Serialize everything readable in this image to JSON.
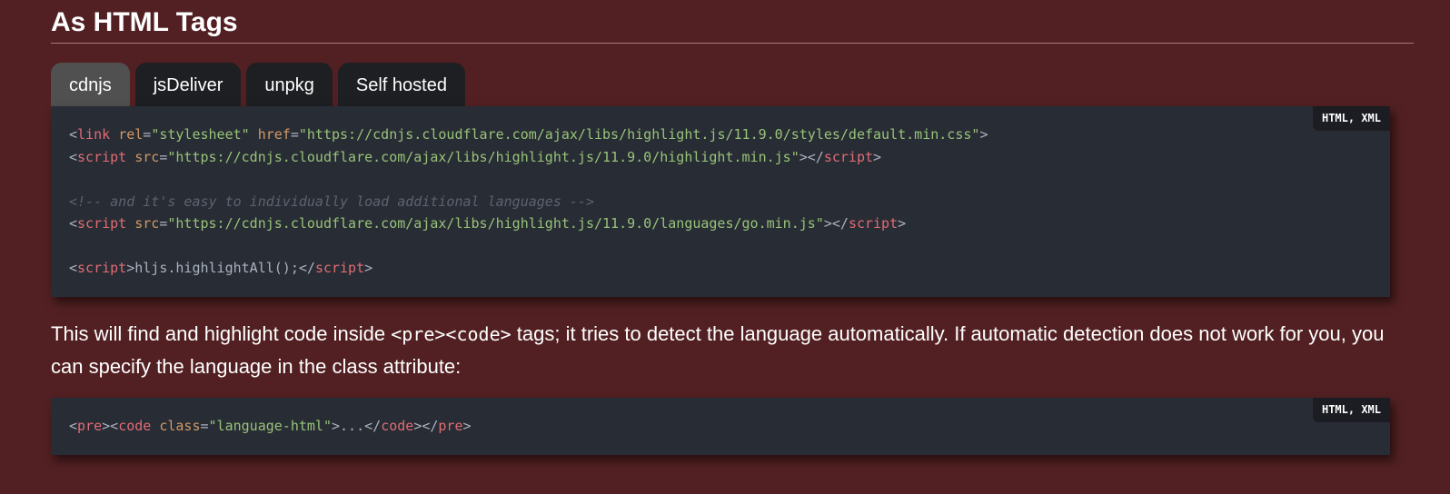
{
  "section": {
    "heading": "As HTML Tags"
  },
  "tabs": [
    {
      "label": "cdnjs",
      "active": true
    },
    {
      "label": "jsDeliver",
      "active": false
    },
    {
      "label": "unpkg",
      "active": false
    },
    {
      "label": "Self hosted",
      "active": false
    }
  ],
  "code_block_1": {
    "language_badge": "HTML, XML",
    "lines": [
      [
        {
          "t": "<",
          "k": "punc"
        },
        {
          "t": "link",
          "k": "tag"
        },
        {
          "t": " ",
          "k": "punc"
        },
        {
          "t": "rel",
          "k": "attr"
        },
        {
          "t": "=",
          "k": "punc"
        },
        {
          "t": "\"stylesheet\"",
          "k": "str"
        },
        {
          "t": " ",
          "k": "punc"
        },
        {
          "t": "href",
          "k": "attr"
        },
        {
          "t": "=",
          "k": "punc"
        },
        {
          "t": "\"https://cdnjs.cloudflare.com/ajax/libs/highlight.js/11.9.0/styles/default.min.css\"",
          "k": "str"
        },
        {
          "t": ">",
          "k": "punc"
        }
      ],
      [
        {
          "t": "<",
          "k": "punc"
        },
        {
          "t": "script",
          "k": "tag"
        },
        {
          "t": " ",
          "k": "punc"
        },
        {
          "t": "src",
          "k": "attr"
        },
        {
          "t": "=",
          "k": "punc"
        },
        {
          "t": "\"https://cdnjs.cloudflare.com/ajax/libs/highlight.js/11.9.0/highlight.min.js\"",
          "k": "str"
        },
        {
          "t": "></",
          "k": "punc"
        },
        {
          "t": "script",
          "k": "tag"
        },
        {
          "t": ">",
          "k": "punc"
        }
      ],
      [],
      [
        {
          "t": "<!-- and it's easy to individually load additional languages -->",
          "k": "com"
        }
      ],
      [
        {
          "t": "<",
          "k": "punc"
        },
        {
          "t": "script",
          "k": "tag"
        },
        {
          "t": " ",
          "k": "punc"
        },
        {
          "t": "src",
          "k": "attr"
        },
        {
          "t": "=",
          "k": "punc"
        },
        {
          "t": "\"https://cdnjs.cloudflare.com/ajax/libs/highlight.js/11.9.0/languages/go.min.js\"",
          "k": "str"
        },
        {
          "t": "></",
          "k": "punc"
        },
        {
          "t": "script",
          "k": "tag"
        },
        {
          "t": ">",
          "k": "punc"
        }
      ],
      [],
      [
        {
          "t": "<",
          "k": "punc"
        },
        {
          "t": "script",
          "k": "tag"
        },
        {
          "t": ">",
          "k": "punc"
        },
        {
          "t": "hljs.highlightAll();",
          "k": "punc"
        },
        {
          "t": "</",
          "k": "punc"
        },
        {
          "t": "script",
          "k": "tag"
        },
        {
          "t": ">",
          "k": "punc"
        }
      ]
    ]
  },
  "paragraph": {
    "before": "This will find and highlight code inside ",
    "inline_code": "<pre><code>",
    "after": " tags; it tries to detect the language automatically. If automatic detection does not work for you, you can specify the language in the class attribute:"
  },
  "code_block_2": {
    "language_badge": "HTML, XML",
    "lines": [
      [
        {
          "t": "<",
          "k": "punc"
        },
        {
          "t": "pre",
          "k": "tag"
        },
        {
          "t": "><",
          "k": "punc"
        },
        {
          "t": "code",
          "k": "tag"
        },
        {
          "t": " ",
          "k": "punc"
        },
        {
          "t": "class",
          "k": "attr"
        },
        {
          "t": "=",
          "k": "punc"
        },
        {
          "t": "\"language-html\"",
          "k": "str"
        },
        {
          "t": ">...</",
          "k": "punc"
        },
        {
          "t": "code",
          "k": "tag"
        },
        {
          "t": "></",
          "k": "punc"
        },
        {
          "t": "pre",
          "k": "tag"
        },
        {
          "t": ">",
          "k": "punc"
        }
      ]
    ]
  },
  "colors": {
    "page_background": "#522022",
    "code_background": "#282c34",
    "tab_background": "#1e1f22",
    "tab_active_background": "#505050",
    "token_tag": "#e06c75",
    "token_attr": "#d19a66",
    "token_string": "#98c379",
    "token_comment": "#5c6370",
    "token_punctuation": "#abb2bf"
  }
}
